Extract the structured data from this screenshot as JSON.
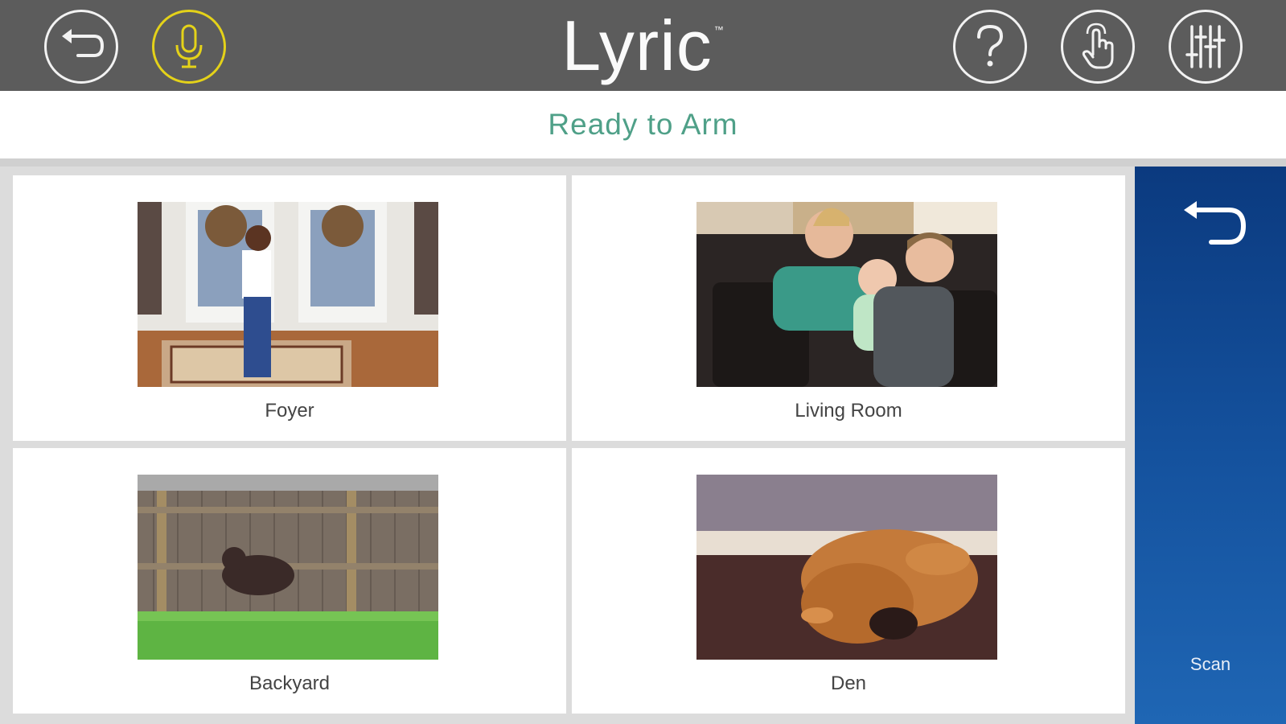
{
  "header": {
    "brand": "Lyric",
    "trademark": "™",
    "icons": [
      "back-icon",
      "microphone-icon",
      "help-icon",
      "touch-icon",
      "settings-sliders-icon"
    ],
    "accent_mic": "#e4d219"
  },
  "status": {
    "text": "Ready to Arm",
    "color": "#4fa088"
  },
  "cameras": [
    {
      "label": "Foyer"
    },
    {
      "label": "Living Room"
    },
    {
      "label": "Backyard"
    },
    {
      "label": "Den"
    }
  ],
  "side_panel": {
    "scan_label": "Scan",
    "icon": "back-icon"
  }
}
